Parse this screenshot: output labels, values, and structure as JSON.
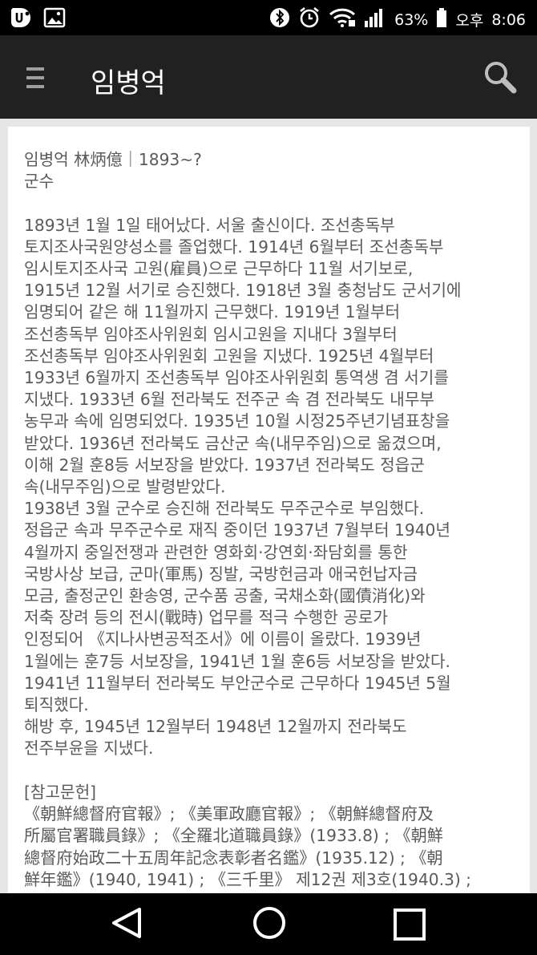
{
  "status_bar": {
    "battery": "63%",
    "time_period": "오후",
    "time": "8:06"
  },
  "app_bar": {
    "title": "임병억"
  },
  "article": {
    "lines": [
      "임병억 林炳億｜1893~?",
      "군수",
      "",
      "1893년 1월 1일 태어났다. 서울 출신이다. 조선총독부",
      "토지조사국원양성소를 졸업했다. 1914년 6월부터 조선총독부",
      "임시토지조사국 고원(雇員)으로 근무하다 11월 서기보로,",
      "1915년 12월 서기로 승진했다. 1918년 3월 충청남도 군서기에",
      "임명되어 같은 해 11월까지 근무했다. 1919년 1월부터",
      "조선총독부 임야조사위원회 임시고원을 지내다 3월부터",
      "조선총독부 임야조사위원회 고원을 지냈다. 1925년 4월부터",
      "1933년 6월까지 조선총독부 임야조사위원회 통역생 겸 서기를",
      "지냈다. 1933년 6월 전라북도 전주군 속 겸 전라북도 내무부",
      "농무과 속에 임명되었다. 1935년 10월 시정25주년기념표창을",
      "받았다. 1936년 전라북도 금산군 속(내무주임)으로 옮겼으며,",
      "이해 2월 훈8등 서보장을 받았다. 1937년 전라북도 정읍군",
      "속(내무주임)으로 발령받았다.",
      "1938년 3월 군수로 승진해 전라북도 무주군수로 부임했다.",
      "정읍군 속과 무주군수로 재직 중이던 1937년 7월부터 1940년",
      "4월까지 중일전쟁과 관련한 영화회·강연회·좌담회를 통한",
      "국방사상 보급, 군마(軍馬) 징발, 국방헌금과 애국헌납자금",
      "모금, 출정군인 환송영, 군수품 공출, 국채소화(國債消化)와",
      "저축 장려 등의 전시(戰時) 업무를 적극 수행한 공로가",
      "인정되어 《지나사변공적조서》에 이름이 올랐다. 1939년",
      "1월에는 훈7등 서보장을, 1941년 1월 훈6등 서보장을 받았다.",
      "1941년 11월부터 전라북도 부안군수로 근무하다 1945년 5월",
      "퇴직했다.",
      "해방 후, 1945년 12월부터 1948년 12월까지 전라북도",
      "전주부윤을 지냈다.",
      "",
      "[참고문헌]",
      "《朝鮮總督府官報》; 《美軍政廳官報》; 《朝鮮總督府及",
      "所屬官署職員錄》; 《全羅北道職員錄》(1933.8) ; 《朝鮮",
      "總督府始政二十五周年記念表彰者名鑑》(1935.12) ; 《朝",
      "鮮年鑑》(1940, 1941) ; 《三千里》 제12권 제3호(1940.3) ;"
    ]
  }
}
